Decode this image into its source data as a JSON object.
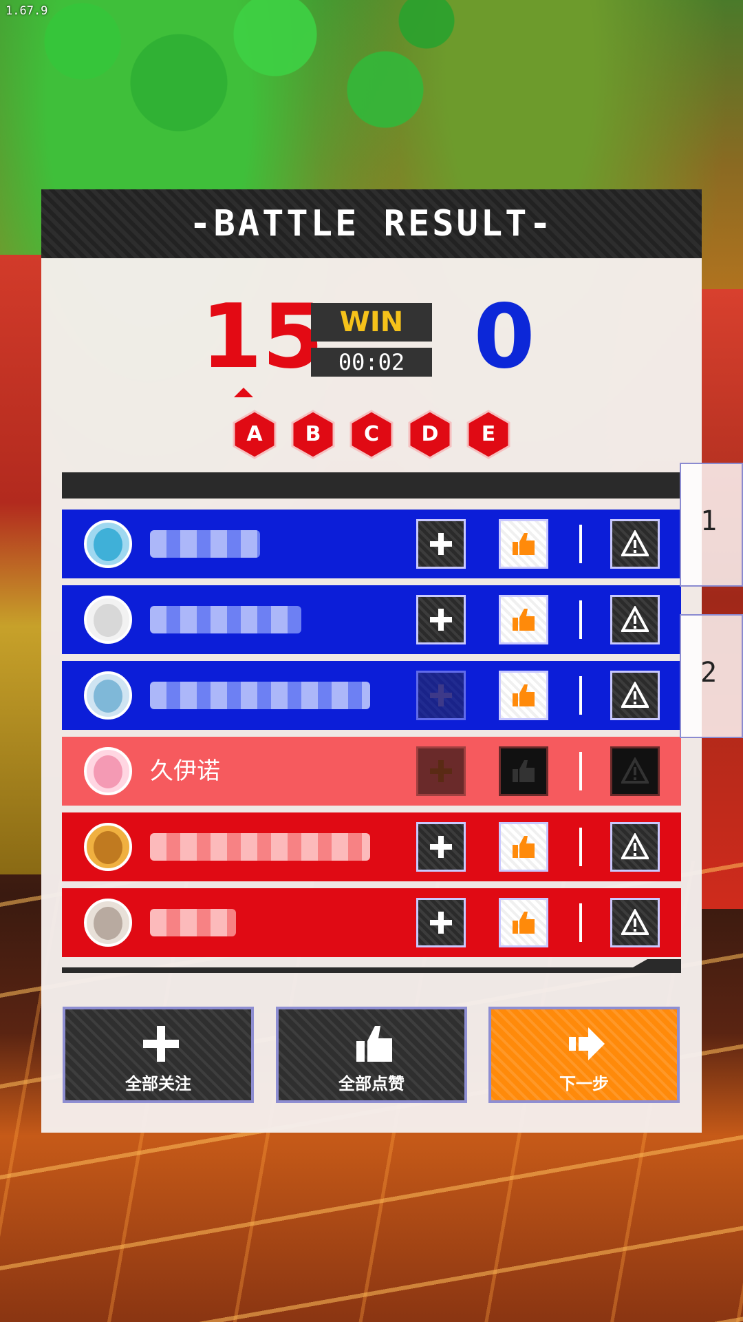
{
  "version": "1.67.9",
  "title": "-BATTLE RESULT-",
  "score": {
    "left": "15",
    "right": "0"
  },
  "result": "WIN",
  "time": "00:02",
  "grades": [
    "A",
    "B",
    "C",
    "D",
    "E"
  ],
  "team_tabs": [
    "1",
    "2"
  ],
  "players": [
    {
      "team": "blue",
      "name": "",
      "follow_enabled": true
    },
    {
      "team": "blue",
      "name": "",
      "follow_enabled": true
    },
    {
      "team": "blue",
      "name": "",
      "follow_enabled": false
    },
    {
      "team": "self",
      "name": "久伊诺",
      "follow_enabled": false
    },
    {
      "team": "red",
      "name": "",
      "follow_enabled": true
    },
    {
      "team": "red",
      "name": "",
      "follow_enabled": true
    }
  ],
  "actions": {
    "follow_all": "全部关注",
    "like_all": "全部点赞",
    "next": "下一步"
  },
  "colors": {
    "red_team": "#e00a14",
    "blue_team": "#0c1ed8",
    "self_row": "#f65a5e",
    "win_text": "#f6c21a",
    "next_button": "#ff8a0a"
  }
}
